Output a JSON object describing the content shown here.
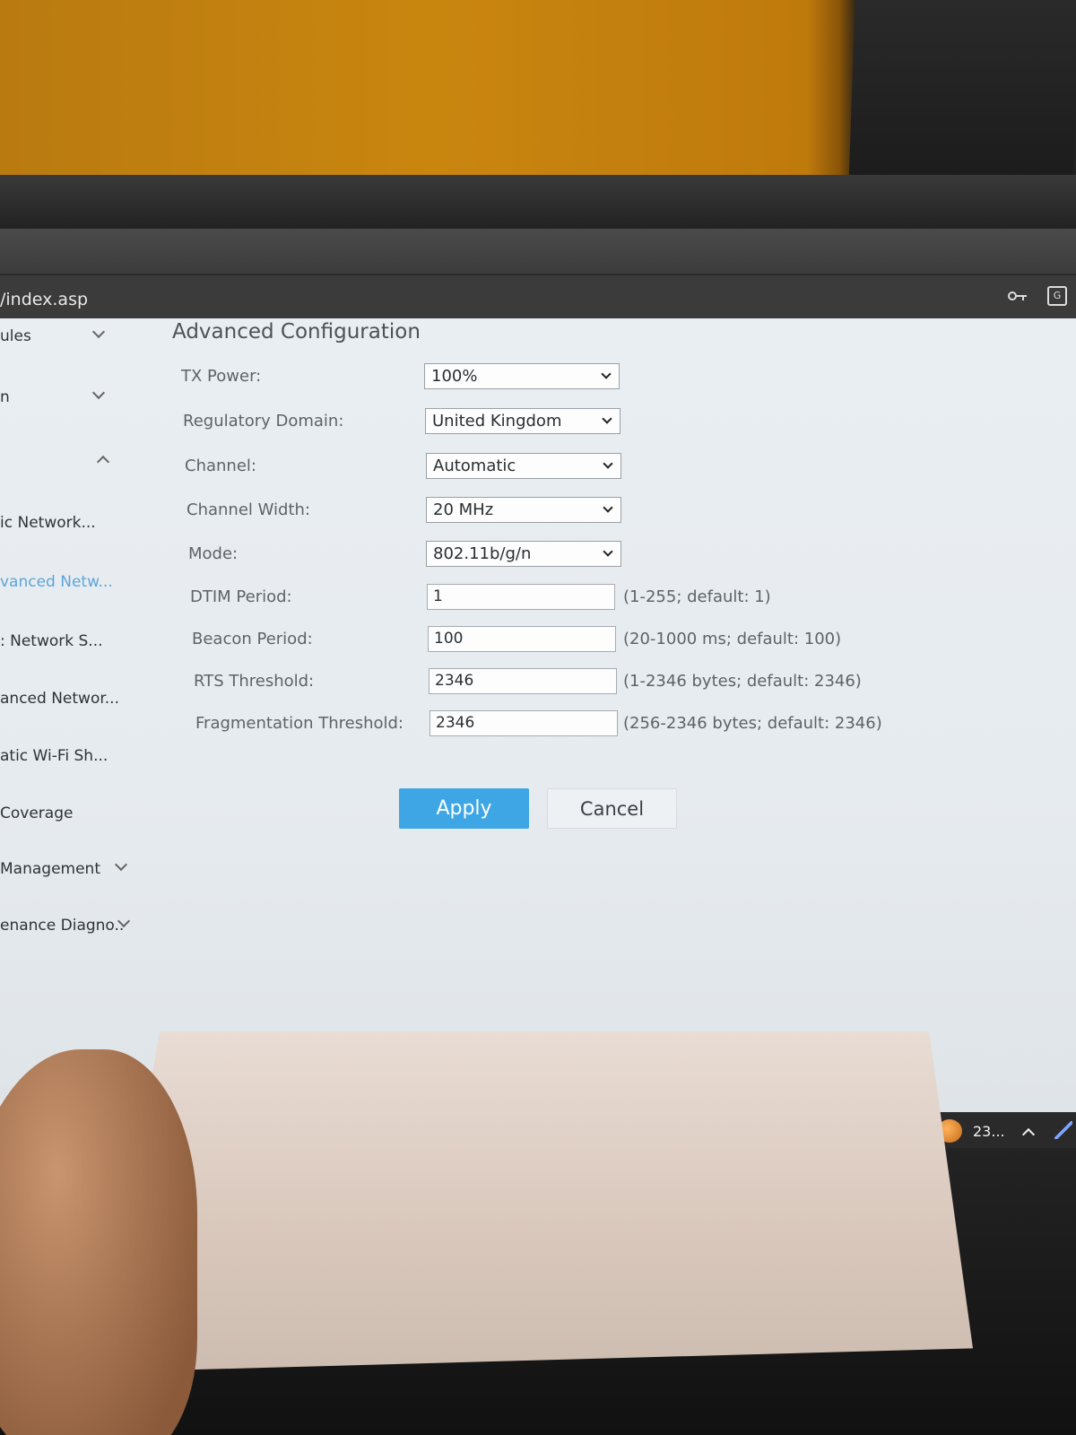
{
  "browser": {
    "url_fragment": "/index.asp",
    "key_icon": "key-icon",
    "translate_icon": "translate-icon"
  },
  "sidebar": {
    "items": [
      {
        "label": "ules"
      },
      {
        "label": "n"
      },
      {
        "label": ""
      },
      {
        "label": "ic Network..."
      },
      {
        "label": "vanced Netw..."
      },
      {
        "label": ": Network S..."
      },
      {
        "label": "anced Networ..."
      },
      {
        "label": "atic Wi-Fi Sh..."
      },
      {
        "label": "Coverage"
      },
      {
        "label": "Management"
      },
      {
        "label": "enance Diagno.."
      }
    ]
  },
  "main": {
    "title": "Advanced Configuration",
    "tx_power": {
      "label": "TX Power:",
      "value": "100%"
    },
    "regulatory": {
      "label": "Regulatory Domain:",
      "value": "United Kingdom"
    },
    "channel": {
      "label": "Channel:",
      "value": "Automatic"
    },
    "channel_width": {
      "label": "Channel Width:",
      "value": "20 MHz"
    },
    "mode": {
      "label": "Mode:",
      "value": "802.11b/g/n"
    },
    "dtim": {
      "label": "DTIM Period:",
      "value": "1",
      "hint": "(1-255; default: 1)"
    },
    "beacon": {
      "label": "Beacon Period:",
      "value": "100",
      "hint": "(20-1000 ms; default: 100)"
    },
    "rts": {
      "label": "RTS Threshold:",
      "value": "2346",
      "hint": "(1-2346 bytes; default: 2346)"
    },
    "frag": {
      "label": "Fragmentation Threshold:",
      "value": "2346",
      "hint": "(256-2346 bytes; default: 2346)"
    },
    "apply_label": "Apply",
    "cancel_label": "Cancel"
  },
  "taskbar": {
    "tray_text": "23...",
    "accent": "#3fa6e6"
  }
}
